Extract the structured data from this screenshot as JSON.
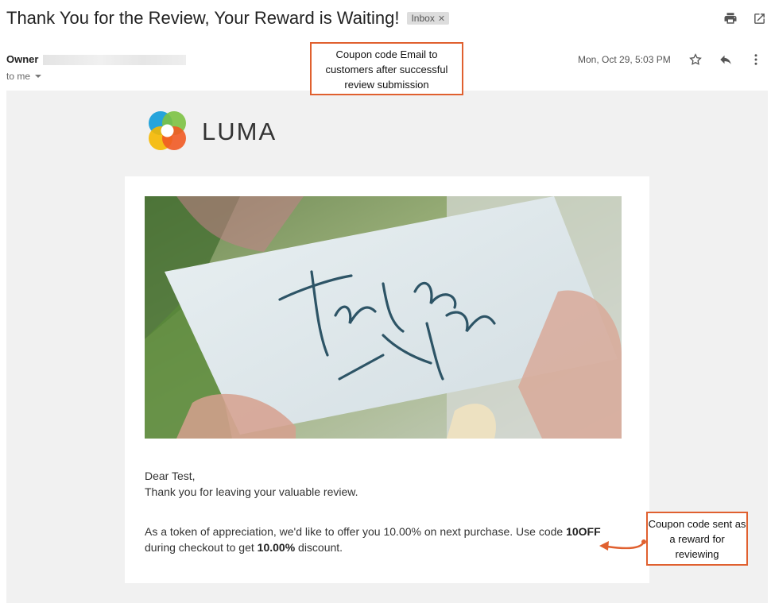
{
  "email": {
    "subject": "Thank You for the Review, Your Reward is Waiting!",
    "label_chip": "Inbox",
    "sender_name": "Owner",
    "recipient": "to me",
    "date": "Mon, Oct 29, 5:03 PM"
  },
  "icons": {
    "print": "print-icon",
    "open_new_window": "open-in-new-window-icon",
    "star": "star-icon",
    "reply": "reply-icon",
    "more": "more-vertical-icon",
    "remove_label": "close-icon",
    "recipient_dropdown": "chevron-down-icon"
  },
  "brand": {
    "name": "LUMA"
  },
  "body": {
    "greeting": "Dear Test,",
    "thanks": "Thank you for leaving your valuable review.",
    "offer_prefix": "As a token of appreciation, we'd like to offer you 10.00% on next purchase. Use code ",
    "coupon_code": "10OFF",
    "offer_middle": "during checkout to get ",
    "discount": "10.00%",
    "offer_suffix": " discount."
  },
  "annotations": {
    "top_note": "Coupon code Email to customers after successful review submission",
    "side_note": "Coupon code sent as a reward for reviewing"
  },
  "colors": {
    "annotation_border": "#e0602f",
    "email_background": "#f1f1f1"
  }
}
